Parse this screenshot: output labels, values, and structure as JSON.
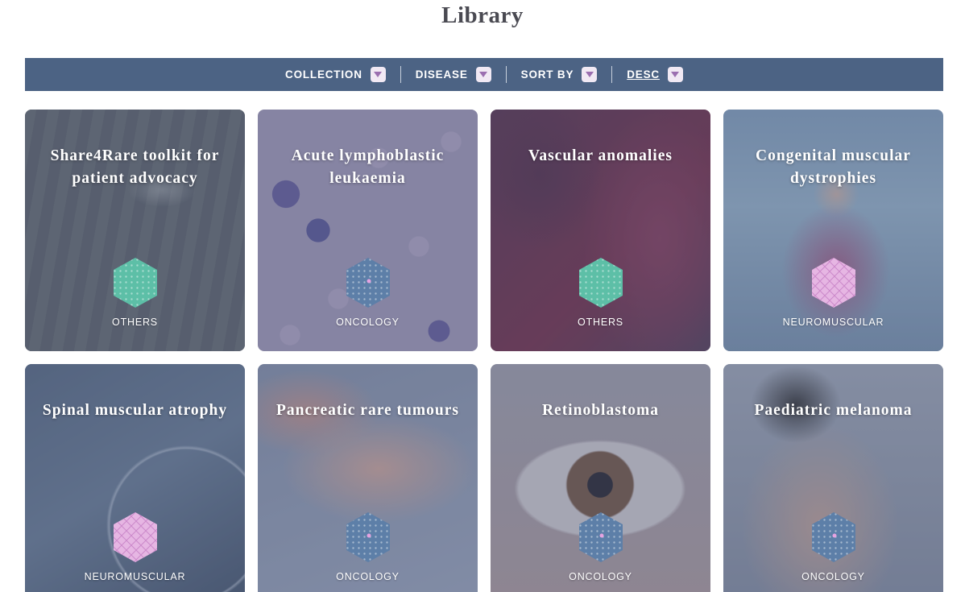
{
  "page": {
    "title": "Library"
  },
  "filters": [
    {
      "label": "COLLECTION",
      "underlined": false
    },
    {
      "label": "DISEASE",
      "underlined": false
    },
    {
      "label": "SORT BY",
      "underlined": false
    },
    {
      "label": "DESC",
      "underlined": true
    }
  ],
  "colors": {
    "filter_bar": "#4c6384",
    "others": "#5dbfa7",
    "oncology": "#5d7fa8",
    "neuromuscular": "#e6b6e3"
  },
  "cards": [
    {
      "title": "Share4Rare toolkit for patient advocacy",
      "category": "OTHERS",
      "icon": "others-hexagon-icon"
    },
    {
      "title": "Acute lymphoblastic leukaemia",
      "category": "ONCOLOGY",
      "icon": "oncology-hexagon-icon"
    },
    {
      "title": "Vascular anomalies",
      "category": "OTHERS",
      "icon": "others-hexagon-icon"
    },
    {
      "title": "Congenital muscular dystrophies",
      "category": "NEUROMUSCULAR",
      "icon": "neuromuscular-hexagon-icon"
    },
    {
      "title": "Spinal muscular atrophy",
      "category": "NEUROMUSCULAR",
      "icon": "neuromuscular-hexagon-icon"
    },
    {
      "title": "Pancreatic rare tumours",
      "category": "ONCOLOGY",
      "icon": "oncology-hexagon-icon"
    },
    {
      "title": "Retinoblastoma",
      "category": "ONCOLOGY",
      "icon": "oncology-hexagon-icon"
    },
    {
      "title": "Paediatric melanoma",
      "category": "ONCOLOGY",
      "icon": "oncology-hexagon-icon"
    }
  ]
}
